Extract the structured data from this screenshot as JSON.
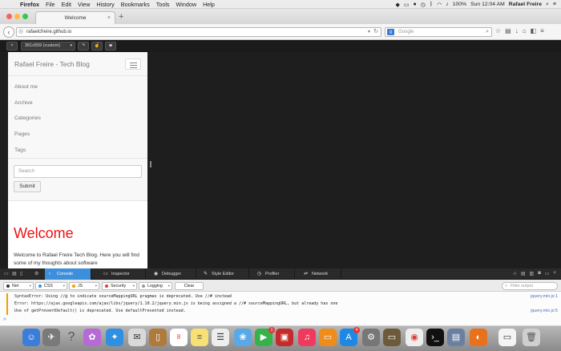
{
  "menubar": {
    "items": [
      "Firefox",
      "File",
      "Edit",
      "View",
      "History",
      "Bookmarks",
      "Tools",
      "Window",
      "Help"
    ],
    "battery": "100%",
    "clock": "Sun 12:04 AM",
    "user": "Rafael Freire"
  },
  "browser": {
    "tab_title": "Welcome",
    "url": "rafaelcfreire.github.io",
    "search_placeholder": "Google"
  },
  "rdm": {
    "close": "×",
    "preset": "361x559 (custom)"
  },
  "site": {
    "brand": "Rafael Freire - Tech Blog",
    "nav": [
      "About me",
      "Archive",
      "Categories",
      "Pages",
      "Tags"
    ],
    "search_placeholder": "Search",
    "submit": "Submit",
    "heading": "Welcome",
    "intro": "Welcome to Rafael Freire Tech Blog. Here you will find some of my thoughts about software"
  },
  "devtools": {
    "tabs": [
      "Console",
      "Inspector",
      "Debugger",
      "Style Editor",
      "Profiler",
      "Network"
    ],
    "filters": [
      "Net",
      "CSS",
      "JS",
      "Security",
      "Logging"
    ],
    "clear": "Clear",
    "filter_placeholder": "Filter output",
    "messages": [
      {
        "text": "SyntaxError: Using //@ to indicate sourceMappingURL pragmas is deprecated. Use //# instead",
        "source": "jquery.min.js:1"
      },
      {
        "text": "Error: https://ajax.googleapis.com/ajax/libs/jquery/1.10.2/jquery.min.js is being assigned a //# sourceMappingURL, but already has one",
        "source": ""
      },
      {
        "text": "Use of getPreventDefault() is deprecated.  Use defaultPrevented instead.",
        "source": "jquery.min.js:5"
      }
    ],
    "prompt": "»"
  },
  "dock": {
    "calendar_day": "8",
    "facetime_badge": "1",
    "appstore_badge": "4"
  },
  "colors": {
    "accent": "#3d8fdc",
    "heading": "#ee1111",
    "warning": "#f0a000"
  }
}
